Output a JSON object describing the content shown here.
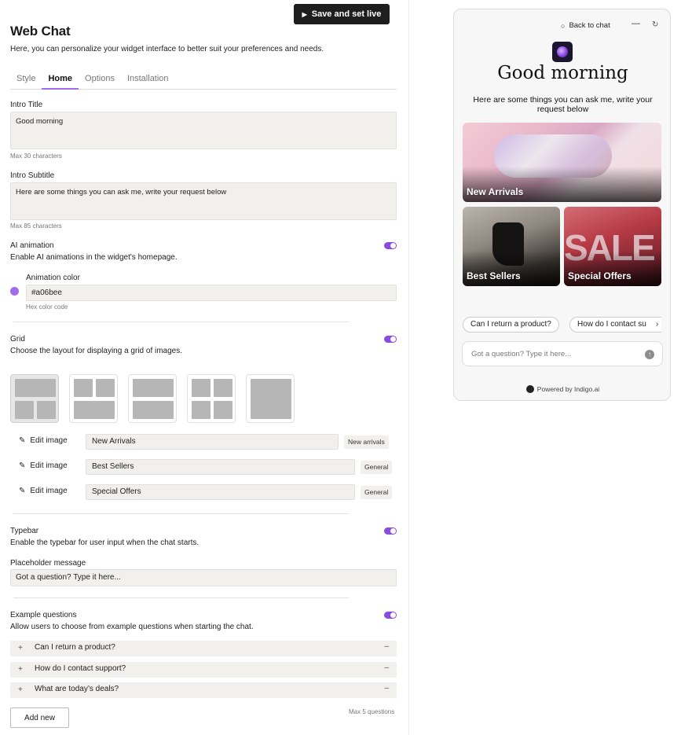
{
  "header": {
    "save_label": "Save and set live",
    "title": "Web Chat",
    "subtitle": "Here, you can personalize your widget interface to better suit your preferences and needs."
  },
  "tabs": [
    {
      "label": "Style",
      "active": false
    },
    {
      "label": "Home",
      "active": true
    },
    {
      "label": "Options",
      "active": false
    },
    {
      "label": "Installation",
      "active": false
    }
  ],
  "intro_title": {
    "label": "Intro Title",
    "value": "Good morning",
    "hint": "Max 30 characters"
  },
  "intro_subtitle": {
    "label": "Intro Subtitle",
    "value": "Here are some things you can ask me, write your request below",
    "hint": "Max 85 characters"
  },
  "ai_animation": {
    "label": "AI animation",
    "description": "Enable AI animations in the widget's homepage.",
    "enabled": true,
    "color_label": "Animation color",
    "color_value": "#a06bee",
    "color_hint": "Hex color code",
    "swatch": "#a06bee"
  },
  "grid": {
    "label": "Grid",
    "description": "Choose the layout for displaying a grid of images.",
    "enabled": true,
    "edit_label": "Edit image",
    "items": [
      {
        "name": "New Arrivals",
        "tag": "New arrivals"
      },
      {
        "name": "Best Sellers",
        "tag": "General"
      },
      {
        "name": "Special Offers",
        "tag": "General"
      }
    ]
  },
  "typebar": {
    "label": "Typebar",
    "description": "Enable the typebar for user input when the chat starts.",
    "enabled": true,
    "placeholder_label": "Placeholder message",
    "placeholder_value": "Got a question? Type it here..."
  },
  "example_questions": {
    "label": "Example questions",
    "description": "Allow users to choose from example questions when starting the chat.",
    "enabled": true,
    "items": [
      "Can I return a product?",
      "How do I contact support?",
      "What are today’s deals?"
    ],
    "add_label": "Add new",
    "hint": "Max 5 questions"
  },
  "widget": {
    "back_label": "Back to chat",
    "greeting": "Good morning",
    "subtitle": "Here are some things you can ask me, write your request below",
    "cards": [
      "New Arrivals",
      "Best Sellers",
      "Special Offers"
    ],
    "chips": [
      "Can I return a product?",
      "How do I contact su"
    ],
    "input_placeholder": "Got a question? Type it here...",
    "powered": "Powered by Indigo.ai"
  },
  "colors": {
    "accent": "#a06bee",
    "toggle": "#8a4be0"
  }
}
